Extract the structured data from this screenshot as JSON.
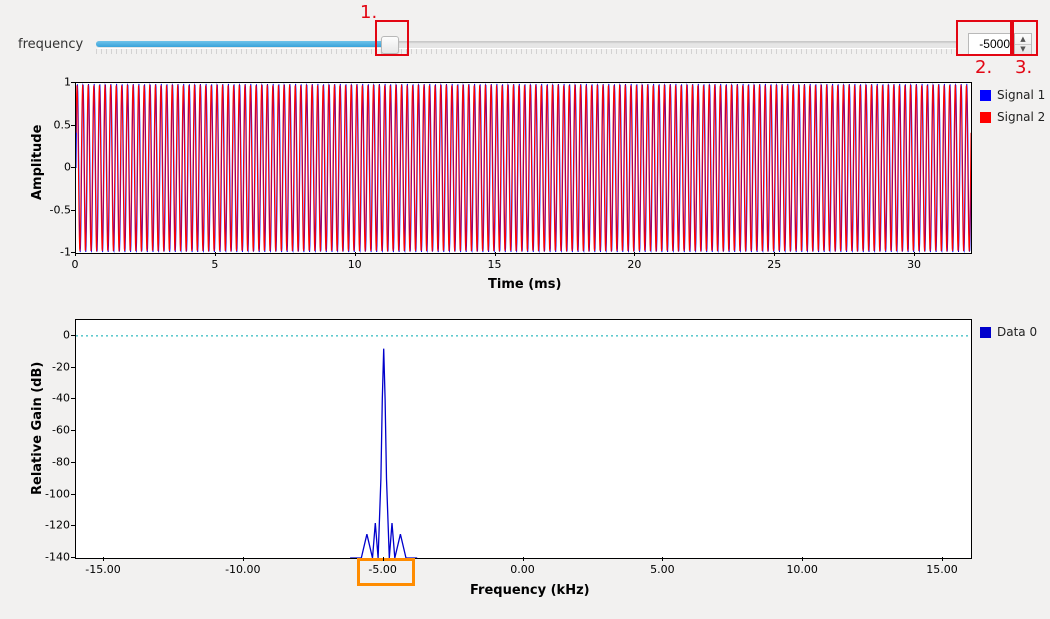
{
  "slider": {
    "label": "frequency",
    "value": "-5000",
    "position_pct": 34
  },
  "annotations": {
    "slider_thumb": "1.",
    "spin_value": "2.",
    "spin_buttons": "3."
  },
  "chart_data": [
    {
      "type": "line",
      "title": "",
      "xlabel": "Time (ms)",
      "ylabel": "Amplitude",
      "xlim": [
        0,
        32
      ],
      "ylim": [
        -1,
        1
      ],
      "xticks": [
        0,
        5,
        10,
        15,
        20,
        25,
        30
      ],
      "yticks": [
        -1,
        -0.5,
        0,
        0.5,
        1
      ],
      "series": [
        {
          "name": "Signal 1",
          "color": "#0000ff",
          "freq_hz": 5000,
          "amplitude": 0.99,
          "sample_rate_khz": 32,
          "note": "≈160 cycles across 32 ms"
        },
        {
          "name": "Signal 2",
          "color": "#ff0000",
          "freq_hz": 5000,
          "amplitude": 0.98,
          "phase_deg": 25
        }
      ]
    },
    {
      "type": "line",
      "title": "",
      "xlabel": "Frequency (kHz)",
      "ylabel": "Relative Gain (dB)",
      "xlim": [
        -16,
        16
      ],
      "ylim": [
        -140,
        10
      ],
      "xticks": [
        -15,
        -10,
        -5,
        0,
        5,
        10,
        15
      ],
      "yticks": [
        -140,
        -120,
        -100,
        -80,
        -60,
        -40,
        -20,
        0
      ],
      "reference_line": {
        "y": 0,
        "color": "#00aab0",
        "dash": true
      },
      "series": [
        {
          "name": "Data 0",
          "color": "#0000cc",
          "x": [
            -6.2,
            -5.8,
            -5.6,
            -5.4,
            -5.3,
            -5.2,
            -5.1,
            -5.05,
            -5.0,
            -4.95,
            -4.9,
            -4.8,
            -4.7,
            -4.6,
            -4.4,
            -4.2,
            -3.8
          ],
          "y": [
            -140,
            -140,
            -125,
            -140,
            -118,
            -140,
            -90,
            -40,
            -8,
            -40,
            -90,
            -140,
            -118,
            -140,
            -125,
            -140,
            -140
          ]
        }
      ],
      "highlight_xtick": -5
    }
  ],
  "legend_top": [
    {
      "label": "Signal 1",
      "color": "#0000ff"
    },
    {
      "label": "Signal 2",
      "color": "#ff0000"
    }
  ],
  "legend_bottom": [
    {
      "label": "Data 0",
      "color": "#0000cc"
    }
  ]
}
